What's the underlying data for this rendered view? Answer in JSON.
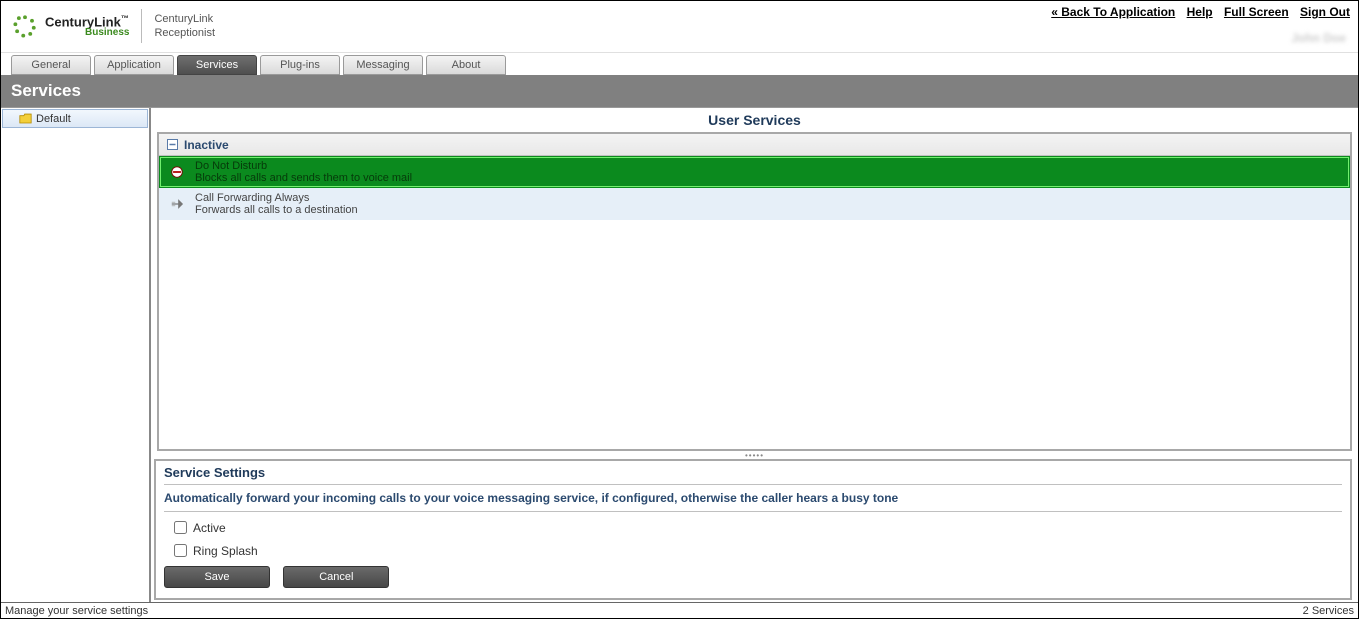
{
  "header": {
    "brand_main": "CenturyLink",
    "brand_sub": "Business",
    "app_name_line1": "CenturyLink",
    "app_name_line2": "Receptionist",
    "username": "John Doe",
    "links": {
      "back": "« Back To Application",
      "help": "Help",
      "fullscreen": "Full Screen",
      "signout": "Sign Out"
    }
  },
  "tabs": {
    "items": [
      {
        "label": "General"
      },
      {
        "label": "Application"
      },
      {
        "label": "Services"
      },
      {
        "label": "Plug-ins"
      },
      {
        "label": "Messaging"
      },
      {
        "label": "About"
      }
    ],
    "active_index": 2
  },
  "section_title": "Services",
  "sidebar": {
    "items": [
      {
        "label": "Default"
      }
    ]
  },
  "user_services": {
    "title": "User Services",
    "group_label": "Inactive",
    "services": [
      {
        "name": "Do Not Disturb",
        "desc": "Blocks all calls and sends them to voice mail",
        "icon": "no-entry-icon",
        "selected": true
      },
      {
        "name": "Call Forwarding Always",
        "desc": "Forwards all calls to a destination",
        "icon": "forward-arrow-icon",
        "selected": false
      }
    ]
  },
  "settings": {
    "title": "Service Settings",
    "description": "Automatically forward your incoming calls to your voice messaging service, if configured, otherwise the caller hears a busy tone",
    "active_label": "Active",
    "ring_splash_label": "Ring Splash",
    "active_checked": false,
    "ring_splash_checked": false,
    "save_label": "Save",
    "cancel_label": "Cancel"
  },
  "footer": {
    "left": "Manage your service settings",
    "right": "2 Services"
  }
}
